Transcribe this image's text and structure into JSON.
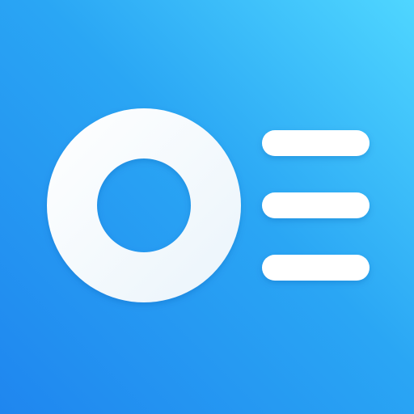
{
  "icon": {
    "name": "app-icon",
    "glyphs": [
      "ring-icon",
      "list-lines-icon"
    ],
    "colors": {
      "background_top_right": "#4fd6ff",
      "background_mid": "#2aa6f4",
      "background_bottom_left": "#1f86ef",
      "foreground": "#ffffff",
      "foreground_shade": "#eaf4fb"
    }
  }
}
